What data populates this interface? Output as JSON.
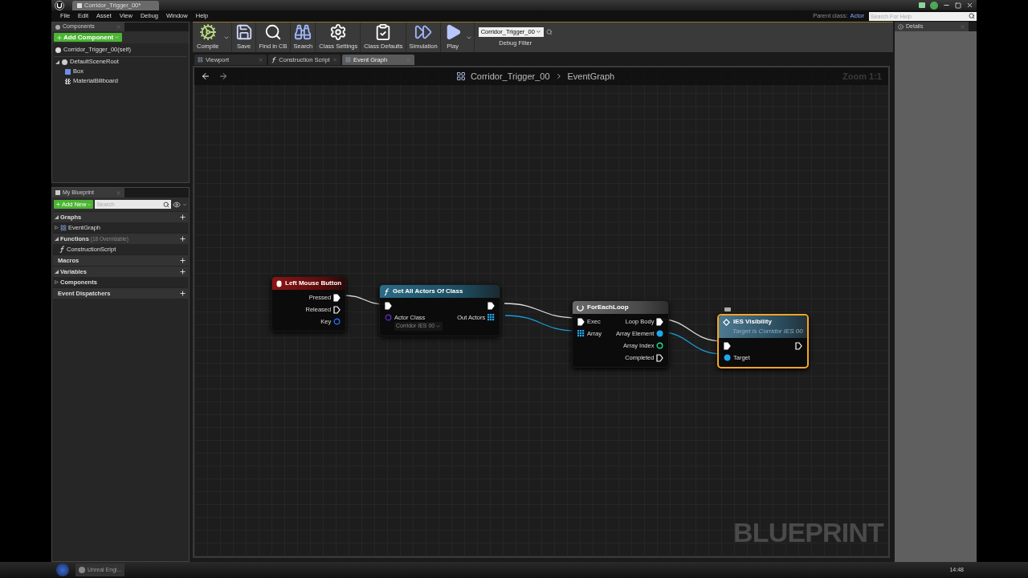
{
  "window": {
    "document_tab": "Corridor_Trigger_00*",
    "menu": [
      "File",
      "Edit",
      "Asset",
      "View",
      "Debug",
      "Window",
      "Help"
    ],
    "parent_class_label": "Parent class:",
    "parent_class": "Actor",
    "help_search_placeholder": "Search For Help"
  },
  "components_panel": {
    "title": "Components",
    "add_button": "Add Component",
    "tree": [
      {
        "label": "Corridor_Trigger_00(self)",
        "kind": "self"
      },
      {
        "label": "DefaultSceneRoot",
        "kind": "root",
        "expanded": true,
        "children": [
          {
            "label": "Box",
            "kind": "box"
          },
          {
            "label": "MaterialBillboard",
            "kind": "billboard"
          }
        ]
      }
    ]
  },
  "toolbar": {
    "buttons": [
      {
        "label": "Compile",
        "kind": "compile",
        "dropdown": true
      },
      {
        "label": "Save",
        "kind": "save",
        "dropdown": false
      },
      {
        "label": "Find in CB",
        "kind": "find",
        "dropdown": false
      },
      {
        "label": "Search",
        "kind": "search",
        "dropdown": false
      },
      {
        "label": "Class Settings",
        "kind": "settings",
        "dropdown": false
      },
      {
        "label": "Class Defaults",
        "kind": "defaults",
        "dropdown": false
      },
      {
        "label": "Simulation",
        "kind": "simulate",
        "dropdown": false
      },
      {
        "label": "Play",
        "kind": "play",
        "dropdown": true
      }
    ],
    "debug_filter": {
      "value": "Corridor_Trigger_00",
      "label": "Debug Filter"
    }
  },
  "editor_tabs": [
    {
      "label": "Viewport",
      "kind": "viewport",
      "selected": false
    },
    {
      "label": "Construction Script",
      "kind": "function",
      "selected": false
    },
    {
      "label": "Event Graph",
      "kind": "graph",
      "selected": true
    }
  ],
  "graph": {
    "breadcrumb": [
      "Corridor_Trigger_00",
      "EventGraph"
    ],
    "zoom": "Zoom 1:1",
    "watermark": "BLUEPRINT",
    "nodes": [
      {
        "kind": "event",
        "title": "Left Mouse Button",
        "selected": false,
        "outputs": [
          {
            "kind": "exec",
            "label": "Pressed",
            "connected": true
          },
          {
            "kind": "exec",
            "label": "Released",
            "connected": false
          },
          {
            "kind": "struct",
            "label": "Key",
            "connected": false
          }
        ]
      },
      {
        "kind": "function",
        "title": "Get All Actors Of Class",
        "selected": false,
        "inputs": [
          {
            "kind": "exec",
            "connected": true
          },
          {
            "kind": "class",
            "label": "Actor Class",
            "default_value": "Corridor IES 00",
            "connected": false
          }
        ],
        "outputs": [
          {
            "kind": "exec",
            "connected": true
          },
          {
            "kind": "array",
            "label": "Out Actors",
            "connected": true
          }
        ]
      },
      {
        "kind": "macro",
        "title": "ForEachLoop",
        "selected": false,
        "inputs": [
          {
            "kind": "exec",
            "label": "Exec",
            "connected": true
          },
          {
            "kind": "array",
            "label": "Array",
            "connected": true
          }
        ],
        "outputs": [
          {
            "kind": "exec",
            "label": "Loop Body",
            "connected": true
          },
          {
            "kind": "object",
            "label": "Array Element",
            "connected": true
          },
          {
            "kind": "int",
            "label": "Array Index",
            "connected": false
          },
          {
            "kind": "exec",
            "label": "Completed",
            "connected": false
          }
        ]
      },
      {
        "kind": "call",
        "title": "IES Visibility",
        "subtitle": "Target is Corridor IES 00",
        "selected": true,
        "inputs": [
          {
            "kind": "exec",
            "connected": true
          },
          {
            "kind": "object",
            "label": "Target",
            "connected": true
          }
        ],
        "outputs": [
          {
            "kind": "exec",
            "connected": false
          }
        ]
      }
    ]
  },
  "my_blueprint": {
    "title": "My Blueprint",
    "add_button": "Add New",
    "search_placeholder": "Search",
    "sections": [
      {
        "label": "Graphs",
        "addable": true,
        "items": [
          {
            "label": "EventGraph",
            "kind": "graph"
          }
        ]
      },
      {
        "label": "Functions",
        "note": "(18 Overridable)",
        "addable": true,
        "items": [
          {
            "label": "ConstructionScript",
            "kind": "function"
          }
        ]
      },
      {
        "label": "Macros",
        "addable": true
      },
      {
        "label": "Variables",
        "addable": true,
        "items": [
          {
            "label": "Components",
            "kind": "category"
          }
        ]
      },
      {
        "label": "Event Dispatchers",
        "addable": true
      }
    ]
  },
  "details_panel": {
    "title": "Details"
  },
  "taskbar": {
    "app": "Unreal Engi...",
    "time": "14:48"
  }
}
